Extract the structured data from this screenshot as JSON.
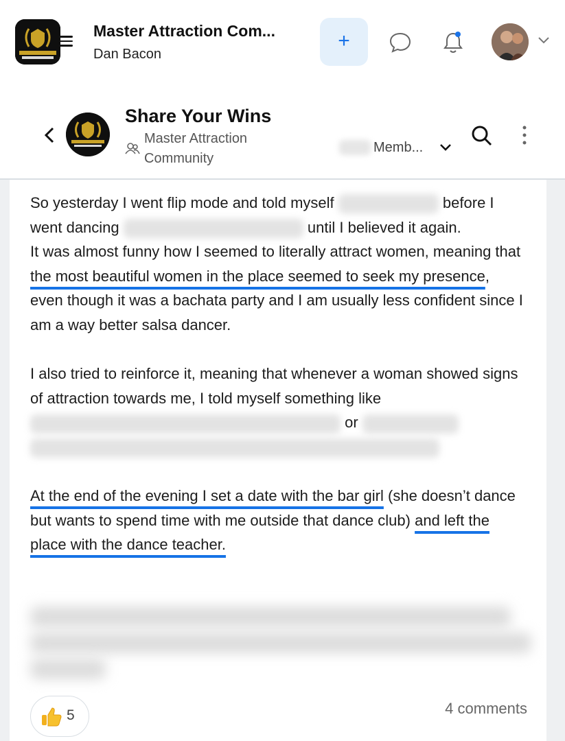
{
  "header": {
    "app_title": "Master Attraction Com...",
    "app_owner": "Dan Bacon",
    "logo_text": "MASTER ATTRACTION COMMUNITY",
    "add_label": "+"
  },
  "group": {
    "title": "Share Your Wins",
    "community": "Master Attraction Community",
    "member_label": "Memb..."
  },
  "post": {
    "p1_a": "So yesterday I went flip mode and told myself",
    "p1_b": "before I went dancing",
    "p1_c": "until I believed it again.",
    "p2_a": "It was almost funny how I seemed to literally attract women, meaning that ",
    "p2_ul": "the most beautiful women in the place seemed to seek my presence",
    "p2_b": ", even though it was a bachata party and I am usually less confident since I am a way better salsa dancer.",
    "p3_a": "I also tried to reinforce it, meaning that whenever a woman showed signs of attraction towards me, I told myself something like",
    "p3_or": "or",
    "p4_ul1": "At the end of the evening I set a date with the bar girl",
    "p4_a": " (she doesn’t dance but wants to spend time with me outside that dance club) ",
    "p4_ul2": "and left the place with the dance teacher."
  },
  "footer": {
    "reaction_count": "5",
    "comments": "4 comments"
  },
  "colors": {
    "accent": "#1673e6",
    "add_button_bg": "#e4f0fb",
    "gold": "#c9a227"
  }
}
